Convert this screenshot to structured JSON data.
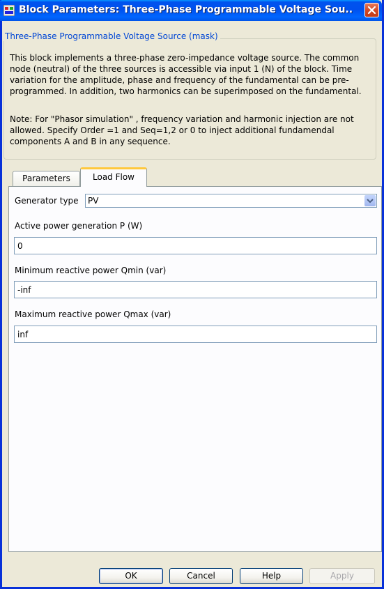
{
  "window": {
    "title": "Block Parameters: Three-Phase Programmable Voltage Sou...",
    "close_label": "✕"
  },
  "group": {
    "legend": "Three-Phase Programmable Voltage Source (mask)",
    "description": "This block implements a three-phase zero-impedance voltage source. The common\nnode (neutral) of the three sources is accessible via input 1 (N) of the block. Time\nvariation for the amplitude, phase and frequency of the fundamental can be pre-\nprogrammed. In addition, two harmonics can be superimposed on the fundamental.",
    "note": "Note: For  \"Phasor simulation\" , frequency variation and harmonic injection are not\nallowed.  Specify  Order =1 and Seq=1,2 or 0 to inject additional fundamendal\ncomponents A and B in  any sequence."
  },
  "tabs": [
    {
      "label": "Parameters",
      "active": false
    },
    {
      "label": "Load Flow",
      "active": true
    }
  ],
  "form": {
    "generator_type_label": "Generator type",
    "generator_type_value": "PV",
    "active_power_label": "Active power generation P (W)",
    "active_power_value": "0",
    "qmin_label": "Minimum reactive power Qmin (var)",
    "qmin_value": "-inf",
    "qmax_label": "Maximum reactive power Qmax (var)",
    "qmax_value": "inf"
  },
  "buttons": {
    "ok": "OK",
    "cancel": "Cancel",
    "help": "Help",
    "apply": "Apply"
  },
  "colors": {
    "titlebar": "#0055ea",
    "legend_text": "#0046d5",
    "active_tab_accent": "#ffc83c",
    "dialog_background": "#ece9d8"
  },
  "icons": {
    "app": "simulink-block-icon",
    "close": "close-icon",
    "dropdown": "chevron-down-icon"
  }
}
